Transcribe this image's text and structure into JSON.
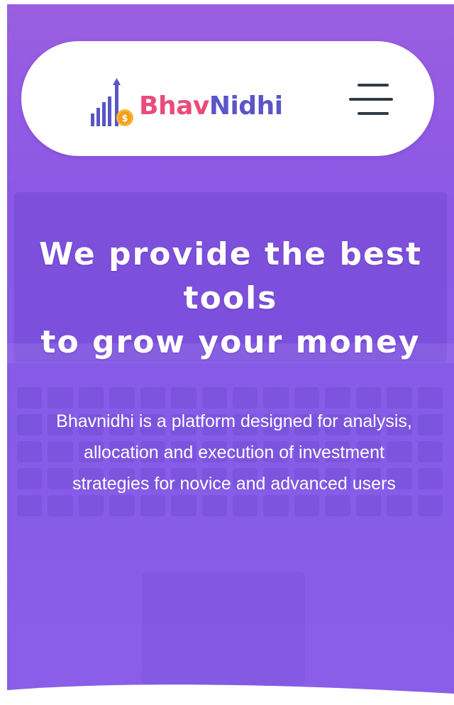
{
  "brand": {
    "name_part1": "Bhav",
    "name_part2": "Nidhi",
    "color_part1": "#e94b7a",
    "color_part2": "#5b55c6",
    "logo_icon": "bar-chart-coin-icon"
  },
  "nav": {
    "menu_icon": "hamburger-menu-icon"
  },
  "hero": {
    "headline_line1": "We provide the best",
    "headline_line2": "tools",
    "headline_line3": "to grow your money",
    "description": "Bhavnidhi is a platform designed for analysis, allocation and execution of investment strategies for novice and advanced users",
    "background_color": "#8a58e6"
  }
}
